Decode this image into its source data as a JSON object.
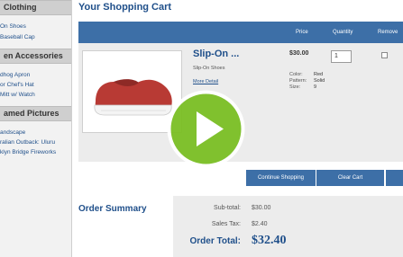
{
  "sidebar": {
    "categories": [
      {
        "title": "Clothing",
        "items": [
          "On Shoes",
          "Baseball Cap"
        ]
      },
      {
        "title": "en Accessories",
        "items": [
          "dhog Apron",
          "or Chef's Hat",
          "Mitt w/ Watch"
        ]
      },
      {
        "title": "amed Pictures",
        "items": [
          "andscape",
          "ralian Outback: Uluru",
          "klyn Bridge Fireworks"
        ]
      }
    ]
  },
  "cart": {
    "title": "Your Shopping Cart",
    "columns": {
      "price": "Price",
      "quantity": "Quantity",
      "remove": "Remove"
    },
    "item": {
      "name": "Slip-On ...",
      "subtitle": "Slip-On Shoes",
      "more_details": "More Detail",
      "price": "$30.00",
      "quantity": "1",
      "attributes": [
        {
          "label": "Color:",
          "value": "Red"
        },
        {
          "label": "Pattern:",
          "value": "Solid"
        },
        {
          "label": "Size:",
          "value": "9"
        }
      ]
    },
    "buttons": {
      "continue": "Continue Shopping",
      "clear": "Clear Cart"
    }
  },
  "summary": {
    "title": "Order Summary",
    "subtotal_label": "Sub-total:",
    "subtotal_value": "$30.00",
    "tax_label": "Sales Tax:",
    "tax_value": "$2.40",
    "total_label": "Order Total:",
    "total_value": "$32.40"
  },
  "colors": {
    "brand_blue": "#3d6fa7",
    "link_blue": "#1f4f8a",
    "play_green": "#7bbf24",
    "shoe_red": "#b83a34"
  },
  "overlay": {
    "icon": "play-icon"
  }
}
